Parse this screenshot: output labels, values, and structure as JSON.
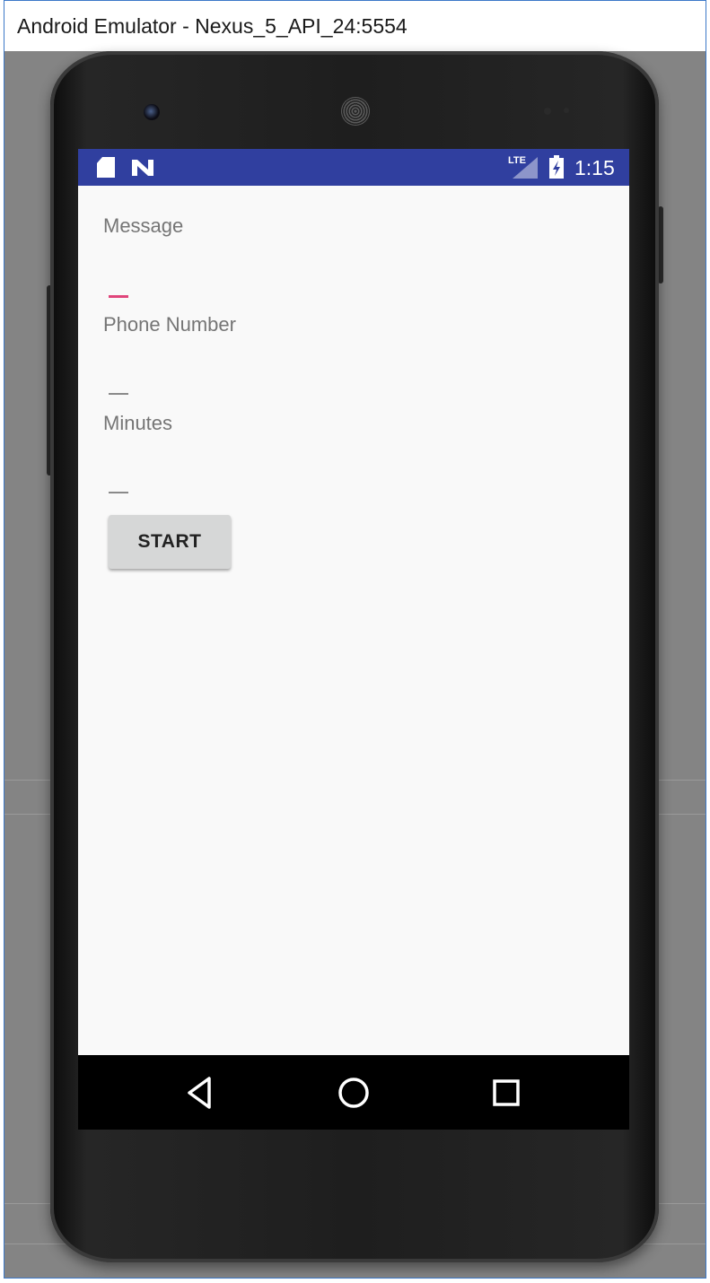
{
  "window": {
    "title": "Android Emulator - Nexus_5_API_24:5554"
  },
  "status_bar": {
    "time": "1:15",
    "network_label": "LTE",
    "icons": [
      "sd-card-icon",
      "n-notification-icon",
      "lte-signal-icon",
      "battery-charging-icon"
    ],
    "color": "#303f9f"
  },
  "form": {
    "fields": [
      {
        "label": "Message",
        "value": "",
        "focused": true
      },
      {
        "label": "Phone Number",
        "value": "",
        "focused": false
      },
      {
        "label": "Minutes",
        "value": "",
        "focused": false
      }
    ],
    "start_label": "START"
  },
  "nav_bar": {
    "icons": [
      "back-icon",
      "home-icon",
      "recents-icon"
    ]
  },
  "colors": {
    "accent": "#e0457b",
    "primary": "#303f9f",
    "screen_background": "#f9f9f9",
    "button_background": "#d6d7d7"
  }
}
